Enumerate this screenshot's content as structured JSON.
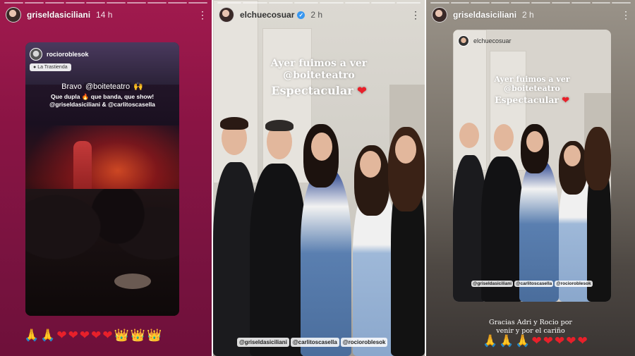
{
  "stories": [
    {
      "username": "griseldasiciliani",
      "time": "14 h",
      "repost": {
        "username": "rocioroblesok",
        "location": "La Trastienda",
        "bravo_prefix": "Bravo",
        "bravo_mention": "@boiteteatro",
        "bravo_emoji": "🙌",
        "text_line1": "Que dupla 🔥 que banda, que show!",
        "text_line2": "@griseldasiciliani & @carlitoscasella"
      },
      "emoji_row": [
        "🙏",
        "🙏",
        "❤",
        "❤",
        "❤",
        "❤",
        "❤",
        "👑",
        "👑",
        "👑"
      ]
    },
    {
      "username": "elchuecosuar",
      "verified": "✓",
      "time": "2 h",
      "caption_line1": "Ayer fuimos a ver",
      "caption_line2": "@boiteteatro",
      "caption_line3": "Espectacular",
      "caption_heart": "❤",
      "tags": [
        "@griseldasiciliani",
        "@carlitoscasella",
        "@rocioroblesok"
      ]
    },
    {
      "username": "griseldasiciliani",
      "time": "2 h",
      "repost": {
        "username": "elchuecosuar",
        "caption_line1": "Ayer fuimos a ver",
        "caption_line2": "@boiteteatro",
        "caption_line3": "Espectacular",
        "caption_heart": "❤",
        "tags": [
          "@griseldasiciliani",
          "@carlitoscasella",
          "@rocioroblesok"
        ]
      },
      "thanks_line1": "Gracias Adri y Rocio por",
      "thanks_line2": "venir y por el cariño",
      "emoji_row": [
        "🙏",
        "🙏",
        "🙏",
        "❤",
        "❤",
        "❤",
        "❤",
        "❤"
      ]
    }
  ],
  "icons": {
    "more": "more-options-icon",
    "verified": "verified-badge-icon"
  },
  "colors": {
    "heart": "#e8202a",
    "verified": "#3897f0",
    "story1_bg": "#8a1444"
  }
}
